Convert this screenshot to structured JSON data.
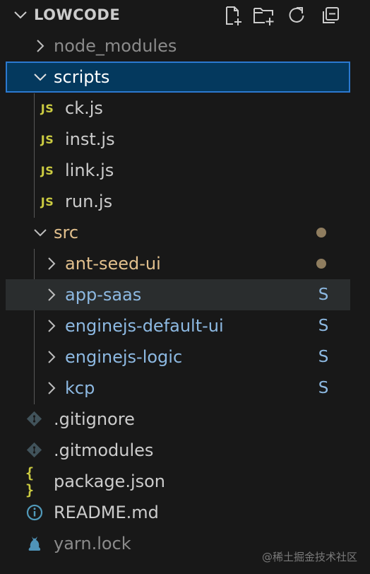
{
  "explorer": {
    "title": "LOWCODE",
    "actions": [
      {
        "name": "new-file-icon",
        "label": "New File"
      },
      {
        "name": "new-folder-icon",
        "label": "New Folder"
      },
      {
        "name": "refresh-icon",
        "label": "Refresh Explorer"
      },
      {
        "name": "collapse-all-icon",
        "label": "Collapse Folders"
      }
    ],
    "items": [
      {
        "label": "node_modules",
        "type": "folder",
        "state": "collapsed",
        "status": "ignored"
      },
      {
        "label": "scripts",
        "type": "folder",
        "state": "expanded",
        "status": "none",
        "selected": true
      },
      {
        "label": "ck.js",
        "type": "js-file",
        "status": "none"
      },
      {
        "label": "inst.js",
        "type": "js-file",
        "status": "none"
      },
      {
        "label": "link.js",
        "type": "js-file",
        "status": "none"
      },
      {
        "label": "run.js",
        "type": "js-file",
        "status": "none"
      },
      {
        "label": "src",
        "type": "folder",
        "state": "expanded",
        "status": "modified-dot"
      },
      {
        "label": "ant-seed-ui",
        "type": "folder",
        "state": "collapsed",
        "status": "modified-dot"
      },
      {
        "label": "app-saas",
        "type": "folder",
        "state": "collapsed",
        "status": "submodule",
        "badge": "S"
      },
      {
        "label": "enginejs-default-ui",
        "type": "folder",
        "state": "collapsed",
        "status": "submodule",
        "badge": "S"
      },
      {
        "label": "enginejs-logic",
        "type": "folder",
        "state": "collapsed",
        "status": "submodule",
        "badge": "S"
      },
      {
        "label": "kcp",
        "type": "folder",
        "state": "collapsed",
        "status": "submodule",
        "badge": "S"
      },
      {
        "label": ".gitignore",
        "type": "git-file",
        "status": "none"
      },
      {
        "label": ".gitmodules",
        "type": "git-file",
        "status": "none"
      },
      {
        "label": "package.json",
        "type": "json-file",
        "status": "none"
      },
      {
        "label": "README.md",
        "type": "info-file",
        "status": "none"
      },
      {
        "label": "yarn.lock",
        "type": "yarn-file",
        "status": "ignored"
      }
    ]
  },
  "icon_text": {
    "js": "JS",
    "json": "{ }"
  },
  "watermark": "@稀土掘金技术社区",
  "colors": {
    "background": "#181818",
    "selection_bg": "#04395e",
    "selection_border": "#2b79d0",
    "modified": "#e2c08d",
    "submodule": "#8db9e2",
    "js_icon": "#cbcb41",
    "ignored": "#8b8b8b"
  }
}
